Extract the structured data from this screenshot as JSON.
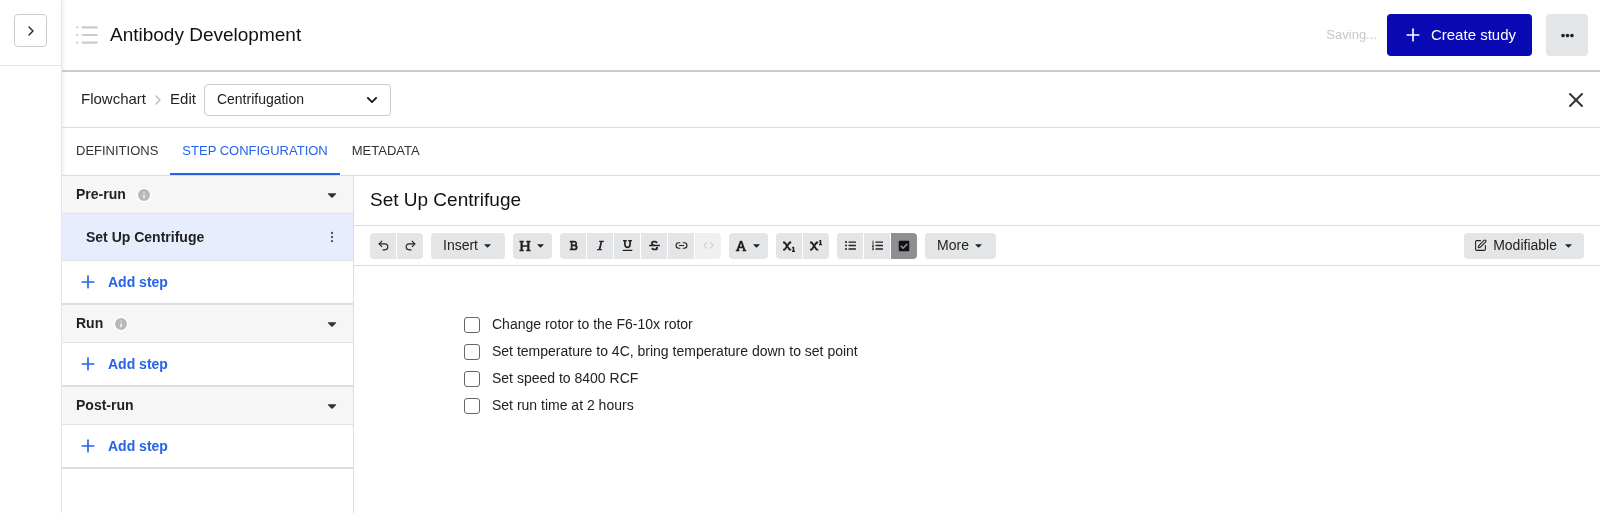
{
  "header": {
    "title": "Antibody Development",
    "status": "Saving...",
    "create_button": "Create study"
  },
  "breadcrumb": {
    "items": [
      "Flowchart",
      "Edit"
    ],
    "select_value": "Centrifugation"
  },
  "tabs": [
    {
      "label": "DEFINITIONS",
      "selected": false
    },
    {
      "label": "STEP CONFIGURATION",
      "selected": true
    },
    {
      "label": "METADATA",
      "selected": false
    }
  ],
  "sections": [
    {
      "title": "Pre-run",
      "info": true,
      "steps": [
        {
          "label": "Set Up Centrifuge",
          "selected": true
        }
      ],
      "add_label": "Add step"
    },
    {
      "title": "Run",
      "info": true,
      "add_label": "Add step"
    },
    {
      "title": "Post-run",
      "info": false,
      "add_label": "Add step"
    }
  ],
  "editor": {
    "title": "Set Up Centrifuge",
    "toolbar": {
      "insert_label": "Insert",
      "more_label": "More",
      "mode_label": "Modifiable",
      "checklist_active": true,
      "code_disabled": true
    },
    "checklist": [
      {
        "text": "Change rotor to the F6-10x rotor",
        "checked": false
      },
      {
        "text": "Set temperature to 4C, bring temperature down to set point",
        "checked": false
      },
      {
        "text": "Set speed to 8400 RCF",
        "checked": false
      },
      {
        "text": "Set run time at 2 hours",
        "checked": false
      }
    ]
  }
}
